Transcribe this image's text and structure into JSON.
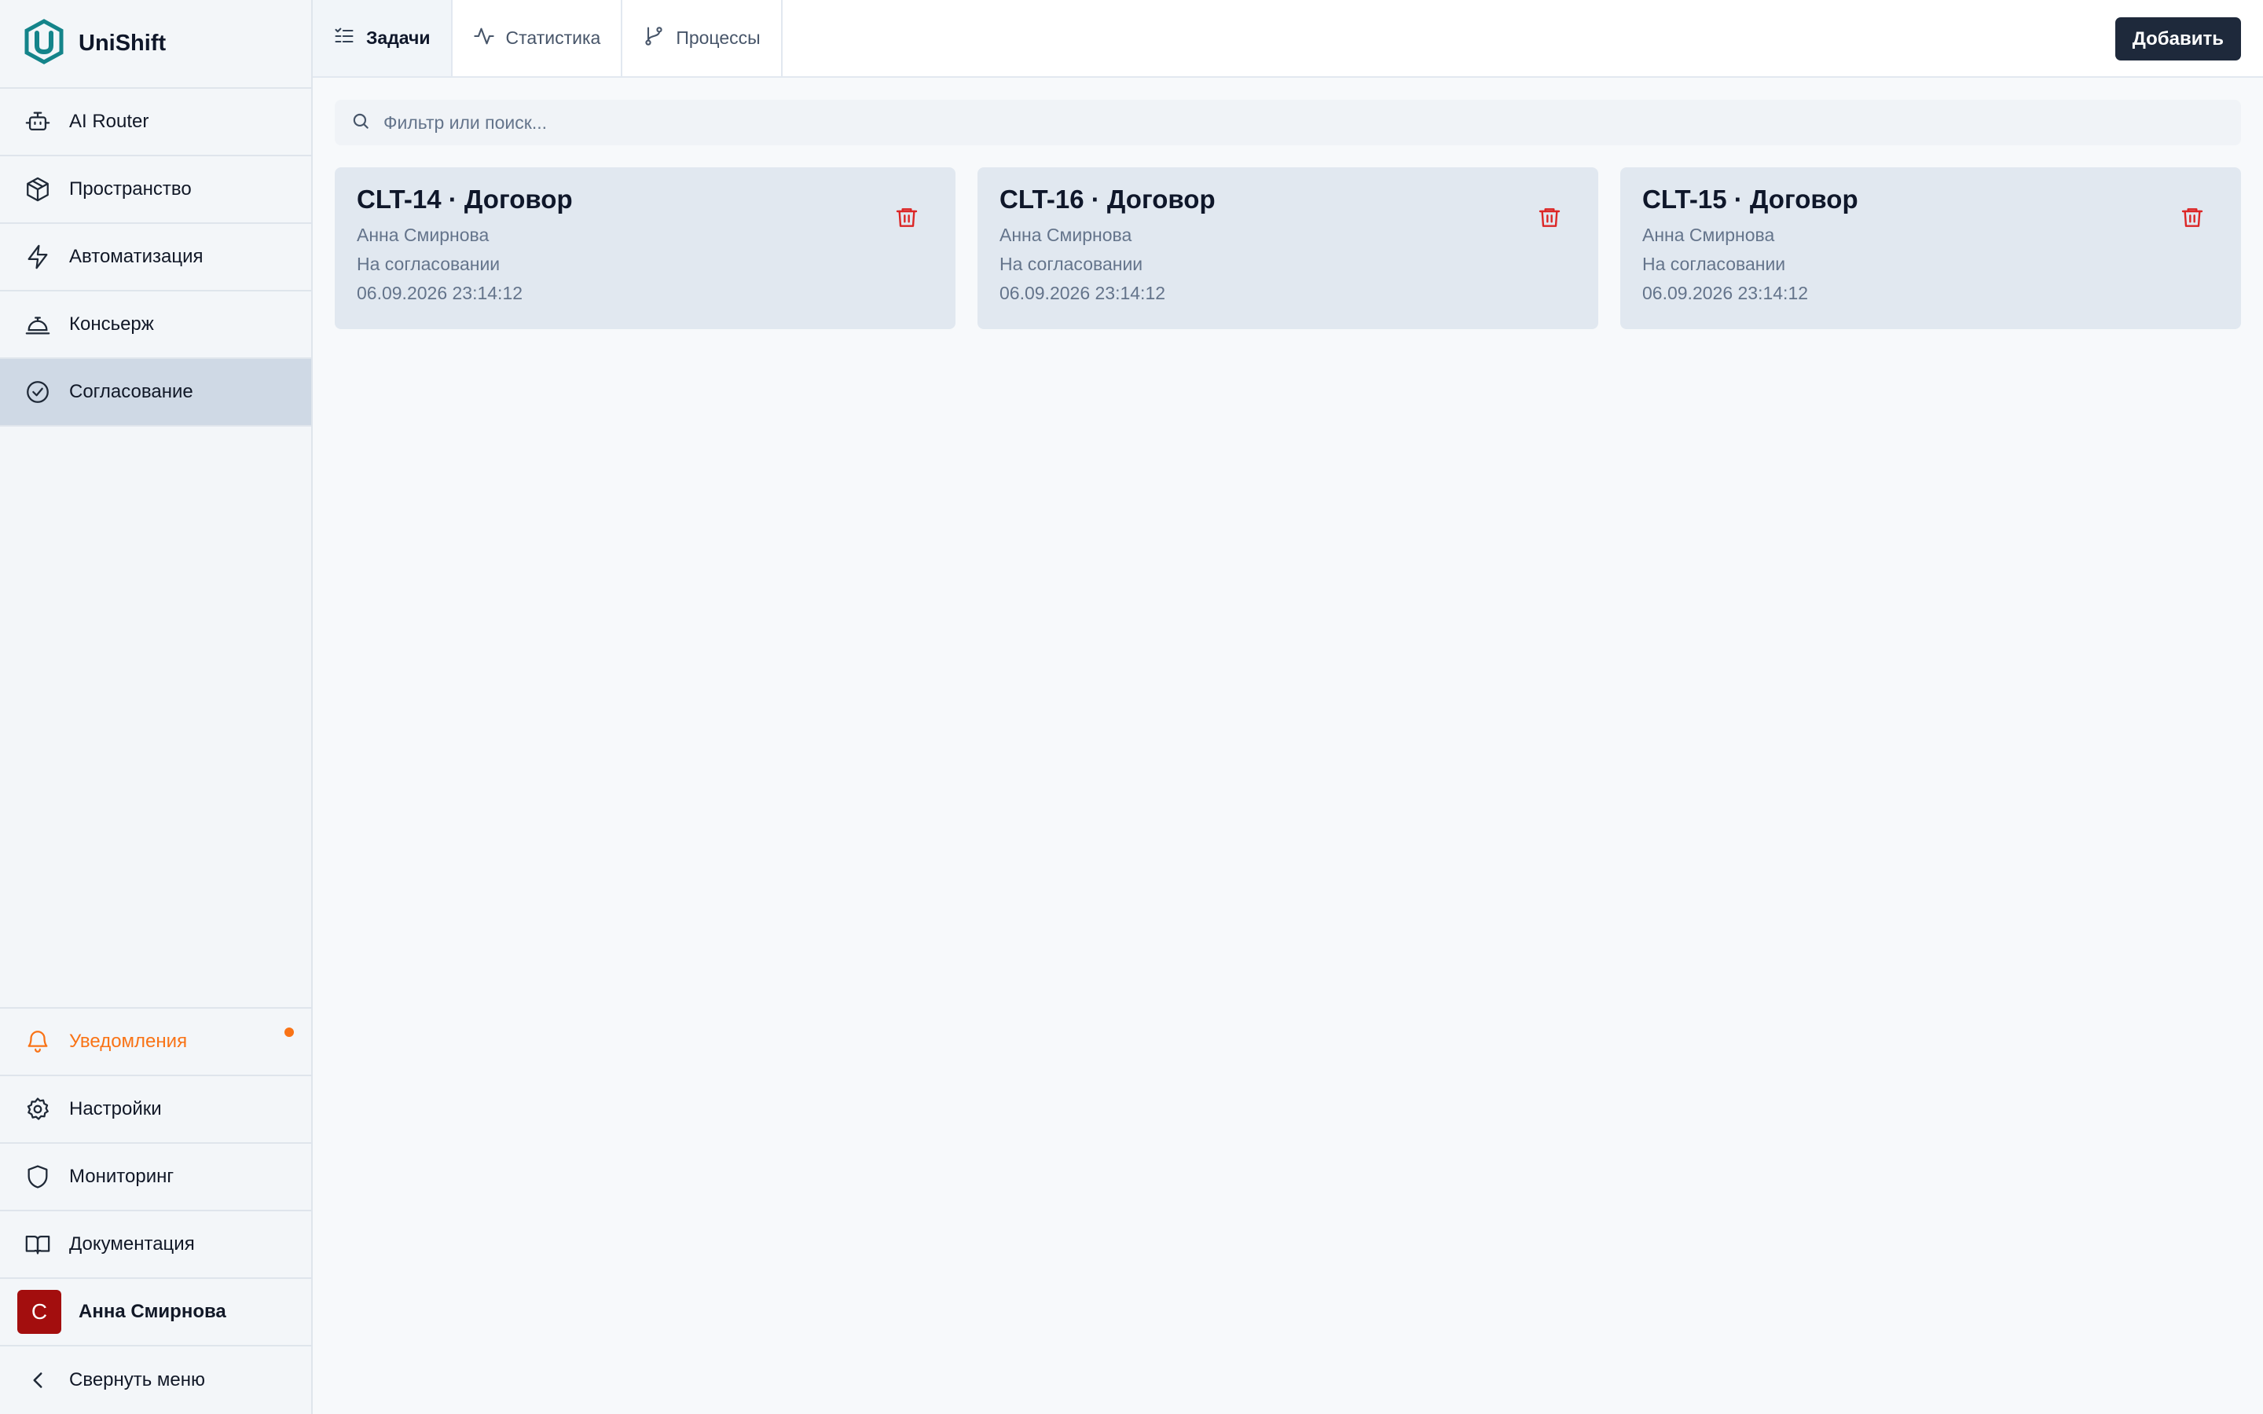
{
  "app": {
    "name": "UniShift"
  },
  "colors": {
    "accent": "#1e293b",
    "brand": "#14848a",
    "notify": "#f97316",
    "danger": "#dc2626",
    "avatar": "#a30e0e"
  },
  "sidebar": {
    "top_items": [
      {
        "label": "AI Router",
        "icon": "bot-icon"
      },
      {
        "label": "Пространство",
        "icon": "cube-icon"
      },
      {
        "label": "Автоматизация",
        "icon": "lightning-icon"
      },
      {
        "label": "Консьерж",
        "icon": "concierge-bell-icon"
      },
      {
        "label": "Согласование",
        "icon": "check-circle-icon",
        "active": true
      }
    ],
    "notifications": {
      "label": "Уведомления",
      "icon": "bell-icon"
    },
    "settings": {
      "label": "Настройки",
      "icon": "gear-icon"
    },
    "monitoring": {
      "label": "Мониторинг",
      "icon": "shield-icon"
    },
    "docs": {
      "label": "Документация",
      "icon": "book-icon"
    },
    "user": {
      "initial": "C",
      "name": "Анна Смирнова"
    },
    "collapse": {
      "label": "Свернуть меню",
      "icon": "chevron-left-icon"
    }
  },
  "tabs": [
    {
      "label": "Задачи",
      "icon": "list-check-icon",
      "active": true
    },
    {
      "label": "Статистика",
      "icon": "activity-icon"
    },
    {
      "label": "Процессы",
      "icon": "git-branch-icon"
    }
  ],
  "toolbar": {
    "add_label": "Добавить"
  },
  "search": {
    "placeholder": "Фильтр или поиск..."
  },
  "cards": [
    {
      "title": "CLT-14 · Договор",
      "person": "Анна Смирнова",
      "status": "На согласовании",
      "date": "06.09.2026 23:14:12"
    },
    {
      "title": "CLT-16 · Договор",
      "person": "Анна Смирнова",
      "status": "На согласовании",
      "date": "06.09.2026 23:14:12"
    },
    {
      "title": "CLT-15 · Договор",
      "person": "Анна Смирнова",
      "status": "На согласовании",
      "date": "06.09.2026 23:14:12"
    }
  ]
}
